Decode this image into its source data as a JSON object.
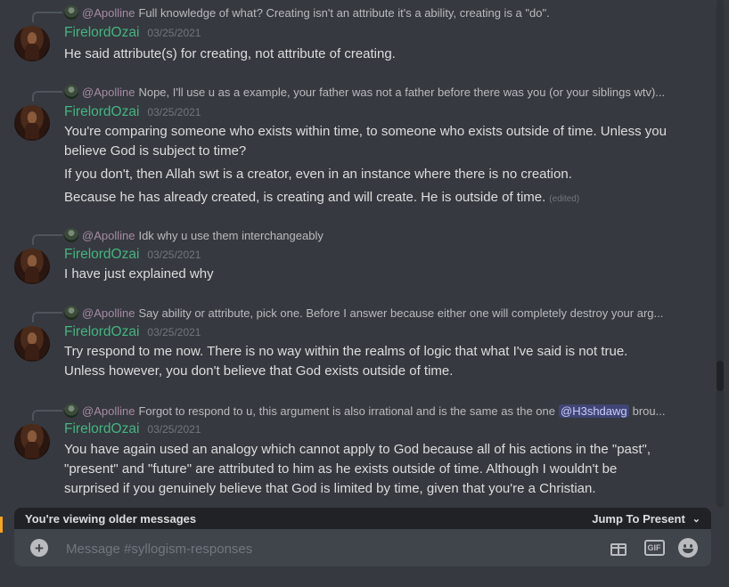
{
  "messages": [
    {
      "reply": {
        "name": "@Apolline",
        "text": "Full knowledge of what? Creating isn't an attribute it's a ability, creating is a \"do\"."
      },
      "author": "FirelordOzai",
      "time": "03/25/2021",
      "lines": [
        "He said attribute(s) for creating, not attribute of creating."
      ]
    },
    {
      "reply": {
        "name": "@Apolline",
        "text": "Nope, I'll use u as a example, your father was not a father before there was you (or your siblings wtv)..."
      },
      "author": "FirelordOzai",
      "time": "03/25/2021",
      "lines": [
        "You're comparing someone who exists within time, to someone who exists outside of time. Unless you believe God is subject to time?",
        "If you don't, then Allah swt is a creator, even in an instance where there is no creation.",
        "Because he has already created, is creating and will create. He is outside of time."
      ],
      "edited": "(edited)"
    },
    {
      "reply": {
        "name": "@Apolline",
        "text": "Idk why u use them interchangeably"
      },
      "author": "FirelordOzai",
      "time": "03/25/2021",
      "lines": [
        "I have just explained why"
      ]
    },
    {
      "reply": {
        "name": "@Apolline",
        "text": "Say ability or attribute, pick one. Before I answer because either one will completely destroy your arg..."
      },
      "author": "FirelordOzai",
      "time": "03/25/2021",
      "lines": [
        "Try respond to me now. There is no way within the realms of logic that what I've said is not true. Unless however, you don't believe that God exists outside of time."
      ]
    },
    {
      "reply": {
        "name": "@Apolline",
        "text": "Forgot to respond to u, this argument is also irrational and is the same as the one",
        "mention": "@H3shdawg",
        "text_after": "brou..."
      },
      "author": "FirelordOzai",
      "time": "03/25/2021",
      "lines": [
        "You have again used an analogy which cannot apply to God because all of his actions in the \"past\", \"present\" and \"future\" are attributed to him as he exists outside of time. Although I wouldn't be surprised if you genuinely believe that God is limited by time, given that you're a Christian."
      ]
    }
  ],
  "older_banner": {
    "text": "You're viewing older messages",
    "jump_label": "Jump To Present"
  },
  "composer": {
    "placeholder": "Message #syllogism-responses"
  },
  "icons": {
    "gift": "gift-icon",
    "gif": "gif-icon",
    "gif_text": "GIF",
    "emoji": "emoji-icon",
    "add": "plus-circle-icon"
  },
  "colors": {
    "username": "#43b581",
    "reply_name": "#a68ba5",
    "mention": "#c9cdfb",
    "background": "#36393f"
  }
}
